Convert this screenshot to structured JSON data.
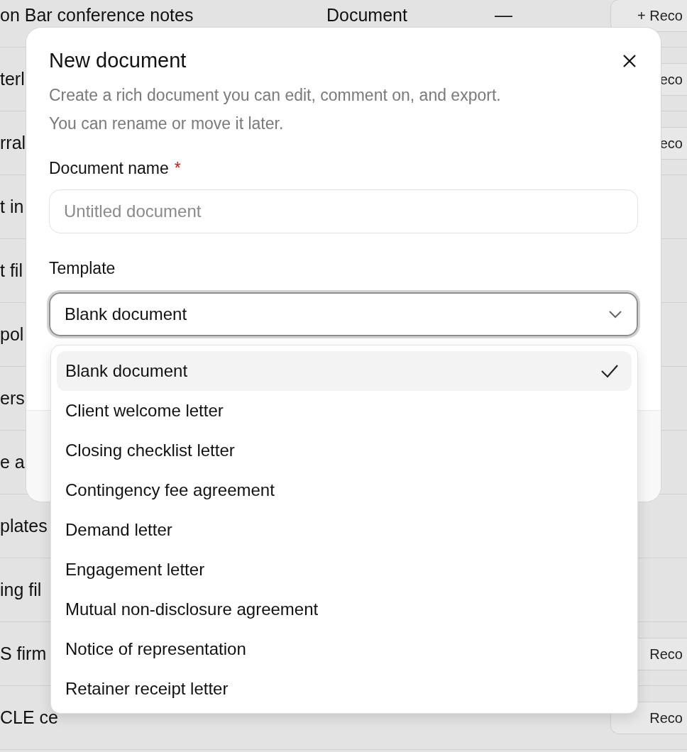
{
  "background_table": {
    "rows": [
      {
        "name": "on Bar conference notes",
        "type": "Document",
        "column_3": "—",
        "action": "+ Reco"
      },
      {
        "name": "terl",
        "action": "eco"
      },
      {
        "name": "rral",
        "action": "eco"
      },
      {
        "name": "t in"
      },
      {
        "name": "t fil"
      },
      {
        "name": "pol"
      },
      {
        "name": "ers"
      },
      {
        "name": "e a"
      },
      {
        "name": "plates"
      },
      {
        "name": "ing fil"
      },
      {
        "name": "S firm",
        "action": "Reco"
      },
      {
        "name": "CLE ce",
        "action": "Reco"
      }
    ]
  },
  "dialog": {
    "title": "New document",
    "description": "Create a rich document you can edit, comment on, and export.\nYou can rename or move it later.",
    "name_field": {
      "label": "Document name",
      "required_mark": "*",
      "placeholder": "Untitled document"
    },
    "template_field": {
      "label": "Template",
      "value": "Blank document",
      "expanded": true,
      "options": [
        {
          "label": "Blank document",
          "selected": true
        },
        {
          "label": "Client welcome letter",
          "selected": false
        },
        {
          "label": "Closing checklist letter",
          "selected": false
        },
        {
          "label": "Contingency fee agreement",
          "selected": false
        },
        {
          "label": "Demand letter",
          "selected": false
        },
        {
          "label": "Engagement letter",
          "selected": false
        },
        {
          "label": "Mutual non-disclosure agreement",
          "selected": false
        },
        {
          "label": "Notice of representation",
          "selected": false
        },
        {
          "label": "Retainer receipt letter",
          "selected": false
        }
      ]
    }
  }
}
